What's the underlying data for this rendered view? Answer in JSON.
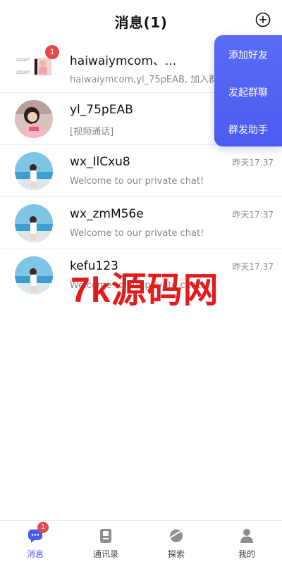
{
  "header": {
    "title": "消息(1)",
    "add_icon": "plus-circle-icon"
  },
  "conversations": [
    {
      "name": "haiwaiymcom、...",
      "message": "haiwaiymcom,yl_75pEAB, 加入群聊",
      "time": "",
      "badge": "1",
      "avatar": "group-avatar",
      "avatar_text_top": "2024/7/",
      "avatar_text_bottom": "2024/7/"
    },
    {
      "name": "yl_75pEAB",
      "message": "[视频通话]",
      "time": "",
      "badge": "",
      "avatar": "user-photo-avatar"
    },
    {
      "name": "wx_IlCxu8",
      "message": "Welcome to our private chat!",
      "time": "昨天17:37",
      "badge": "",
      "avatar": "beach-photo-avatar"
    },
    {
      "name": "wx_zmM56e",
      "message": "Welcome to our private chat!",
      "time": "昨天17:37",
      "badge": "",
      "avatar": "beach-photo-avatar"
    },
    {
      "name": "kefu123",
      "message": "Welcome to our private chat!",
      "time": "昨天17:37",
      "badge": "",
      "avatar": "beach-photo-avatar"
    }
  ],
  "popup_menu": {
    "items": [
      {
        "label": "添加好友"
      },
      {
        "label": "发起群聊"
      },
      {
        "label": "群发助手"
      }
    ],
    "color": "#5062f2"
  },
  "watermark": {
    "text": "7k源码网",
    "color": "#e31b1b"
  },
  "tabbar": {
    "tabs": [
      {
        "label": "消息",
        "icon": "chat-bubble-icon",
        "badge": "1",
        "active": true
      },
      {
        "label": "通讯录",
        "icon": "contacts-book-icon",
        "active": false
      },
      {
        "label": "探索",
        "icon": "planet-icon",
        "active": false
      },
      {
        "label": "我的",
        "icon": "person-icon",
        "active": false
      }
    ],
    "active_color": "#4a5af0"
  }
}
